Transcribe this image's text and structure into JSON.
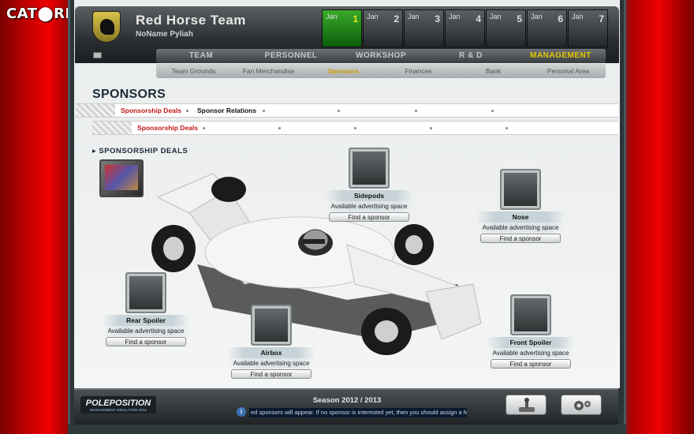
{
  "watermark": "CAT⬤RRENT.ORG",
  "header": {
    "team_name": "Red Horse Team",
    "manager_name": "NoName Pyliah",
    "calendar": [
      {
        "month": "Jan",
        "day": "1",
        "active": true
      },
      {
        "month": "Jan",
        "day": "2",
        "active": false
      },
      {
        "month": "Jan",
        "day": "3",
        "active": false
      },
      {
        "month": "Jan",
        "day": "4",
        "active": false
      },
      {
        "month": "Jan",
        "day": "5",
        "active": false
      },
      {
        "month": "Jan",
        "day": "6",
        "active": false
      },
      {
        "month": "Jan",
        "day": "7",
        "active": false
      }
    ]
  },
  "main_nav": [
    "TEAM",
    "PERSONNEL",
    "WORKSHOP",
    "R & D",
    "MANAGEMENT"
  ],
  "main_nav_active": "MANAGEMENT",
  "sub_nav": [
    "Team Grounds",
    "Fan Merchandise",
    "Sponsors",
    "Finances",
    "Bank",
    "Personal Area"
  ],
  "sub_nav_active": "Sponsors",
  "page_title": "SPONSORS",
  "tabs": {
    "row1": [
      "Sponsorship Deals",
      "Sponsor Relations"
    ],
    "row2": [
      "Sponsorship Deals"
    ]
  },
  "section_label": "SPONSORSHIP DEALS",
  "slots": {
    "sidepods": {
      "name": "Sidepods",
      "availability": "Available advertising space",
      "button": "Find a sponsor"
    },
    "nose": {
      "name": "Nose",
      "availability": "Available advertising space",
      "button": "Find a sponsor"
    },
    "rear_spoiler": {
      "name": "Rear Spoiler",
      "availability": "Available advertising space",
      "button": "Find a sponsor"
    },
    "airbox": {
      "name": "Airbox",
      "availability": "Available advertising space",
      "button": "Find a sponsor"
    },
    "front_spoiler": {
      "name": "Front Spoiler",
      "availability": "Available advertising space",
      "button": "Find a sponsor"
    }
  },
  "footer": {
    "logo_text": "POLEPOSITION",
    "logo_subtext": "MANAGEMENT SIMULATION 2012",
    "season": "Season 2012 / 2013",
    "ticker": "ed sponsors will appear. If no sponsor is interested yet, then you should assign a few"
  },
  "colors": {
    "accent_active": "#e6c800",
    "tab_red": "#c21818",
    "calendar_active": "#1e8a1a"
  }
}
